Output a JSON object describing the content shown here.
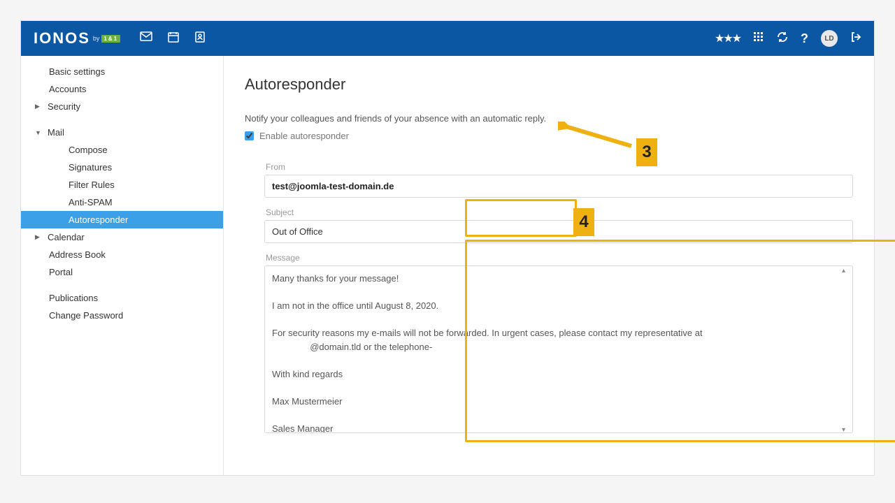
{
  "brand": {
    "name": "IONOS",
    "sub": "by",
    "badge": "1&1"
  },
  "avatar": "LD",
  "sidebar": {
    "basic": "Basic settings",
    "accounts": "Accounts",
    "security": "Security",
    "mail": "Mail",
    "mail_items": {
      "compose": "Compose",
      "signatures": "Signatures",
      "filter": "Filter Rules",
      "antispam": "Anti-SPAM",
      "autoresponder": "Autoresponder"
    },
    "calendar": "Calendar",
    "address": "Address Book",
    "portal": "Portal",
    "publications": "Publications",
    "changepw": "Change Password"
  },
  "page": {
    "title": "Autoresponder",
    "desc": "Notify your colleagues and friends of your absence with an automatic reply.",
    "enable_label": "Enable autoresponder",
    "from_label": "From",
    "from_value": "test@joomla-test-domain.de",
    "subject_label": "Subject",
    "subject_value": "Out of Office",
    "message_label": "Message",
    "message_value": "Many thanks for your message!\n\nI am not in the office until August 8, 2020.\n\nFor security reasons my e-mails will not be forwarded. In urgent cases, please contact my representative at\n               @domain.tld or the telephone-\n\nWith kind regards\n\nMax Mustermeier\n\nSales Manager"
  },
  "callouts": {
    "c3": "3",
    "c4": "4"
  }
}
